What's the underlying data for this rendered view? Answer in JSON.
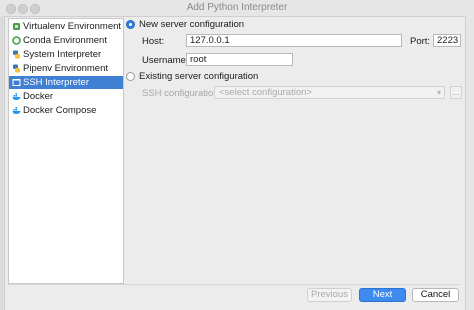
{
  "window": {
    "title": "Add Python Interpreter"
  },
  "sidebar": {
    "items": [
      {
        "label": "Virtualenv Environment",
        "icon": "virtualenv-icon",
        "selected": false
      },
      {
        "label": "Conda Environment",
        "icon": "conda-icon",
        "selected": false
      },
      {
        "label": "System Interpreter",
        "icon": "python-icon",
        "selected": false
      },
      {
        "label": "Pipenv Environment",
        "icon": "pipenv-icon",
        "selected": false
      },
      {
        "label": "SSH Interpreter",
        "icon": "ssh-icon",
        "selected": true
      },
      {
        "label": "Docker",
        "icon": "docker-icon",
        "selected": false
      },
      {
        "label": "Docker Compose",
        "icon": "docker-compose-icon",
        "selected": false
      }
    ]
  },
  "main": {
    "new_server": {
      "radio_label": "New server configuration",
      "selected": true,
      "host_label": "Host:",
      "host_value": "127.0.0.1",
      "port_label": "Port:",
      "port_value": "2223",
      "username_label": "Username:",
      "username_value": "root"
    },
    "existing_server": {
      "radio_label": "Existing server configuration",
      "selected": false,
      "ssh_label": "SSH configuration:",
      "ssh_value": "<select configuration>",
      "browse_label": "..."
    }
  },
  "footer": {
    "previous_label": "Previous",
    "next_label": "Next",
    "cancel_label": "Cancel"
  },
  "colors": {
    "selection": "#3f7fd4",
    "primary_button": "#3d8bf0"
  }
}
